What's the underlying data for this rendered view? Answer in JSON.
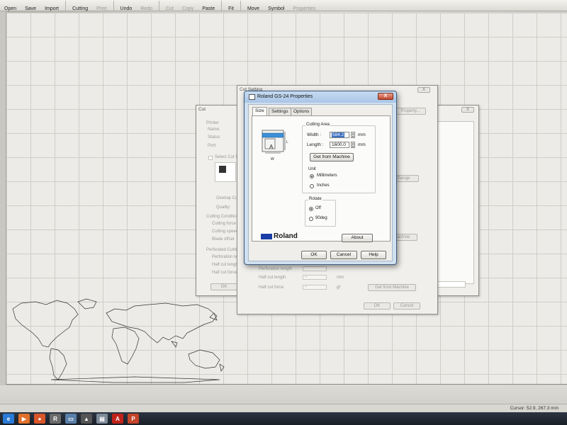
{
  "toolbar": {
    "items": [
      {
        "label": "Open",
        "enabled": true
      },
      {
        "label": "Save",
        "enabled": true
      },
      {
        "label": "Import",
        "enabled": true
      },
      {
        "label": "Cutting",
        "enabled": true
      },
      {
        "label": "Print",
        "enabled": false
      },
      {
        "label": "Undo",
        "enabled": true
      },
      {
        "label": "Redo",
        "enabled": false
      },
      {
        "label": "Cut",
        "enabled": false
      },
      {
        "label": "Copy",
        "enabled": false
      },
      {
        "label": "Paste",
        "enabled": true
      },
      {
        "label": "Fit",
        "enabled": true
      },
      {
        "label": "Move",
        "enabled": true
      },
      {
        "label": "Symbol",
        "enabled": true
      },
      {
        "label": "Properties",
        "enabled": false
      }
    ]
  },
  "status_bar": {
    "cursor": "Cursor: 52.9, 267.3 mm"
  },
  "cut_dialog": {
    "title": "Cut",
    "close": "X",
    "printer_label": "Printer",
    "name_label": "Name:",
    "status_label": "Status:",
    "port_label": "Port:",
    "select_cut_label": "Select Cut D",
    "overlap_label": "Overlap Cutti",
    "quality_label": "Quality:",
    "cutting_conditions": "Cutting Conditions",
    "cutting_force": "Cutting force",
    "cutting_speed": "Cutting speed",
    "blade_offset": "Blade offset",
    "perforated_cutting": "Perforated Cutting",
    "perforation_length": "Perforation len",
    "half_cut_length": "Half cut length",
    "half_cut_force": "Half cut force",
    "ok": "OK"
  },
  "cut_setting_dialog": {
    "title": "Cut Setting",
    "close": "X",
    "property_button": "Property...",
    "change_button": "Change",
    "get_machine_top": "Machine",
    "perforation_length": "Perforation length",
    "half_cut_length": "Half cut length",
    "half_cut_force": "Half cut force",
    "unit_mm": "mm",
    "unit_gf": "gf",
    "dash": "--",
    "get_from_machine": "Get from Machine",
    "ok": "OK",
    "cancel": "Cancel"
  },
  "props_dialog": {
    "title": "Roland GS-24 Properties",
    "close": "X",
    "tabs": [
      "Size",
      "Settings",
      "Options"
    ],
    "active_tab": 0,
    "cutting_area": {
      "title": "Cutting Area",
      "width_label": "Width :",
      "width_value": "584.2",
      "length_label": "Length :",
      "length_value": "1600.0",
      "unit": "mm",
      "get_from_machine": "Get from Machine"
    },
    "unit_group": {
      "title": "Unit",
      "options": [
        "Millimeters",
        "Inches"
      ],
      "selected": 0
    },
    "rotate_group": {
      "title": "Rotate",
      "options": [
        "Off",
        "90deg"
      ],
      "selected": 0
    },
    "diagram_labels": {
      "length": "L",
      "width": "W",
      "sample": "A"
    },
    "brand": "Roland",
    "about": "About",
    "ok": "OK",
    "cancel": "Cancel",
    "help": "Help"
  },
  "taskbar": {
    "apps": [
      {
        "name": "internet-explorer-icon",
        "glyph": "e",
        "color": "#2a7bd6"
      },
      {
        "name": "media-player-icon",
        "glyph": "▶",
        "color": "#e0712a"
      },
      {
        "name": "firefox-icon",
        "glyph": "●",
        "color": "#d9562a"
      },
      {
        "name": "roland-app-icon",
        "glyph": "R",
        "color": "#6b6b6b"
      },
      {
        "name": "window-icon",
        "glyph": "▭",
        "color": "#5a7fa8"
      },
      {
        "name": "eject-icon",
        "glyph": "▲",
        "color": "#555"
      },
      {
        "name": "document-icon",
        "glyph": "▤",
        "color": "#7d8a99"
      },
      {
        "name": "acrobat-icon",
        "glyph": "A",
        "color": "#c0231b"
      },
      {
        "name": "powerpoint-icon",
        "glyph": "P",
        "color": "#c4452a"
      }
    ]
  }
}
